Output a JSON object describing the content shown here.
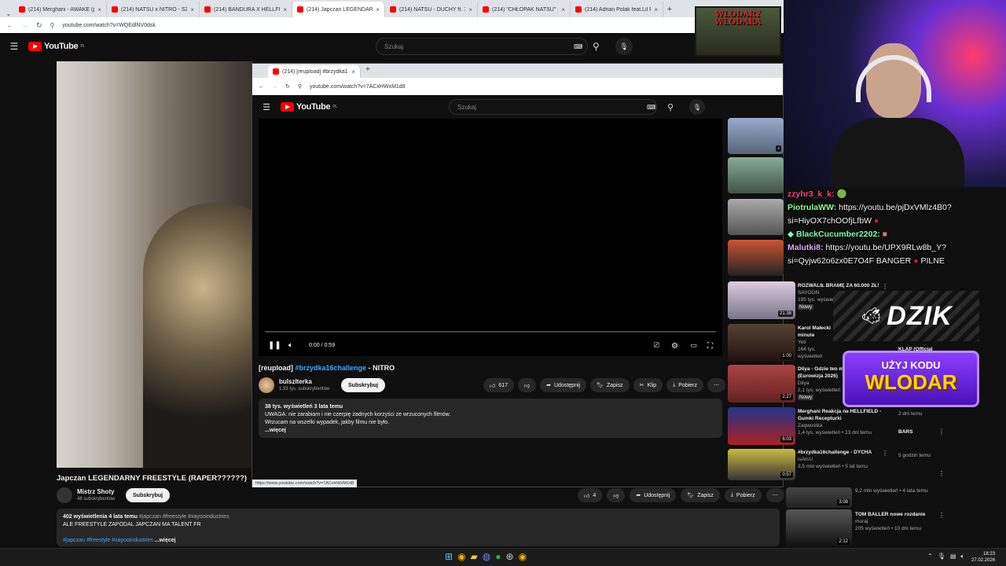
{
  "browser": {
    "tabs": [
      "(214) Merghani - AWAKE (prod.",
      "(214) NATSU x NITRO - SZPILK",
      "(214) BANDURA X HELLFIELD X",
      "(214) Japczan LEGENDARNY FF",
      "(214) NATSU - DUCHY ft. 7 (OFF",
      "(214) \"CHŁOPAK NATSU\" - YouT",
      "(214) Adrian Polak feat.Lil Prom"
    ],
    "url": "youtube.com/watch?v=WQEdlNV0dsk"
  },
  "yt": {
    "logo": "YouTube",
    "region": "PL",
    "search_placeholder": "Szukaj"
  },
  "bg_video": {
    "title": "Japczan LEGENDARNY FREESTYLE (RAPER??????)",
    "channel": "Mistrz Shoty",
    "subs": "48 subskrybentów",
    "subscribe": "Subskrybuj",
    "likes": "4",
    "share": "Udostępnij",
    "save": "Zapisz",
    "download": "Pobierz",
    "meta": "402 wyświetlenia  4 lata temu",
    "hashtags_top": "#japczan #freestyle #xayooindustries",
    "desc_line": "ALE FREESTYLE ZAPODAL JAPCZAN MA TALENT FR",
    "hashtags_bottom": "#japczan #freestyle #xayooindustries",
    "more": "...więcej"
  },
  "popup": {
    "tab_title": "(214) [reupload] #brzydka16c",
    "url": "youtube.com/watch?v=7ACxHWxM1d8",
    "search_placeholder": "Szukaj",
    "time": "0:00 / 0:59",
    "title_prefix": "[reupload]",
    "title_tag": "#brzydka16challenge",
    "title_suffix": "- NITRO",
    "channel": "bulszlterka",
    "subs": "1,93 tys. subskrybentów",
    "subscribe": "Subskrybuj",
    "likes": "617",
    "share": "Udostępnij",
    "save": "Zapisz",
    "clip": "Klip",
    "download": "Pobierz",
    "desc_meta": "38 tys. wyświetleń  3 lata temu",
    "desc_l1": "UWAGA: nie zarabiam i nie czerpię żadnych korzyści ze wrzuconych filmów.",
    "desc_l2": "Wrzucam na wszelki wypadek, jakby filmu nie było.",
    "more": "...więcej",
    "status_url": "https://www.youtube.com/watch?v=7ACxHWxM1d8"
  },
  "recs": [
    {
      "title": "ROZWALIŁ BRAMĘ ZA 60.000 ZŁ!",
      "channel": "SAYOON",
      "views": "195 tys. wyświetleń",
      "badge": "Nowy",
      "dur": "21:38"
    },
    {
      "title": "Karol Małecki minute",
      "channel": "Yeti",
      "views": "164 tys. wyświetleń",
      "dur": "1:00"
    },
    {
      "title": "Diiya - Gdzie ten m (Eurowizja 2026)",
      "channel": "Diiya",
      "views": "2,1 tys. wyświetleń",
      "badge": "Nowy",
      "dur": "2:27"
    },
    {
      "title": "Merghani Reakcja na HELLFIELD - Gumki Recepturki",
      "channel": "Zagwostka",
      "views": "1,4 tys. wyświetleń • 13 dni temu",
      "dur": "6:03"
    },
    {
      "title": "#brzydka16challenge - DYCHA",
      "channel": "isAmU",
      "views": "3,5 mln wyświetleń • 5 lat temu",
      "dur": "0:57"
    },
    {
      "title": "TOM BALLER nowe rozdanie",
      "channel": "muraj",
      "views": "205 wyświetleń • 10 dni temu",
      "dur": "2:12"
    }
  ],
  "recs_partial": {
    "r1": "9,2 mln wyświetleń • 4 lata temu",
    "r2": "KLAP (Official",
    "r3": "2 dni temu",
    "r4": "BARS",
    "r5": "5 godzin temu",
    "r6": "3:08"
  },
  "chat": [
    {
      "user": "zzyhr3_k_k:",
      "color": "#ff3c8c",
      "text": ""
    },
    {
      "user": "PiotrulaWW:",
      "color": "#8cff8c",
      "text": "https://youtu.be/pjDxVMlz4B0? si=HiyOX7chOOfjLfbW"
    },
    {
      "user": "BlackCucumber2202:",
      "color": "#7cffb0",
      "text": ""
    },
    {
      "user": "Malutki8:",
      "color": "#d8a8ff",
      "text": "https://youtu.be/UPX9RLw8b_Y? si=Qyjw62o6zx0E7O4F BANGER",
      "tail": "PILNE"
    }
  ],
  "overlays": {
    "banner": "WLODARY WLODARA",
    "dzik": "DZIK",
    "promo_top": "UŻYJ KODU",
    "promo_code": "WLODAR"
  },
  "taskbar": {
    "time": "18:23",
    "date": "27.02.2026"
  },
  "colors": {
    "accent": "#ff0000",
    "link": "#3ea6ff",
    "promo": "#7b2cff"
  }
}
